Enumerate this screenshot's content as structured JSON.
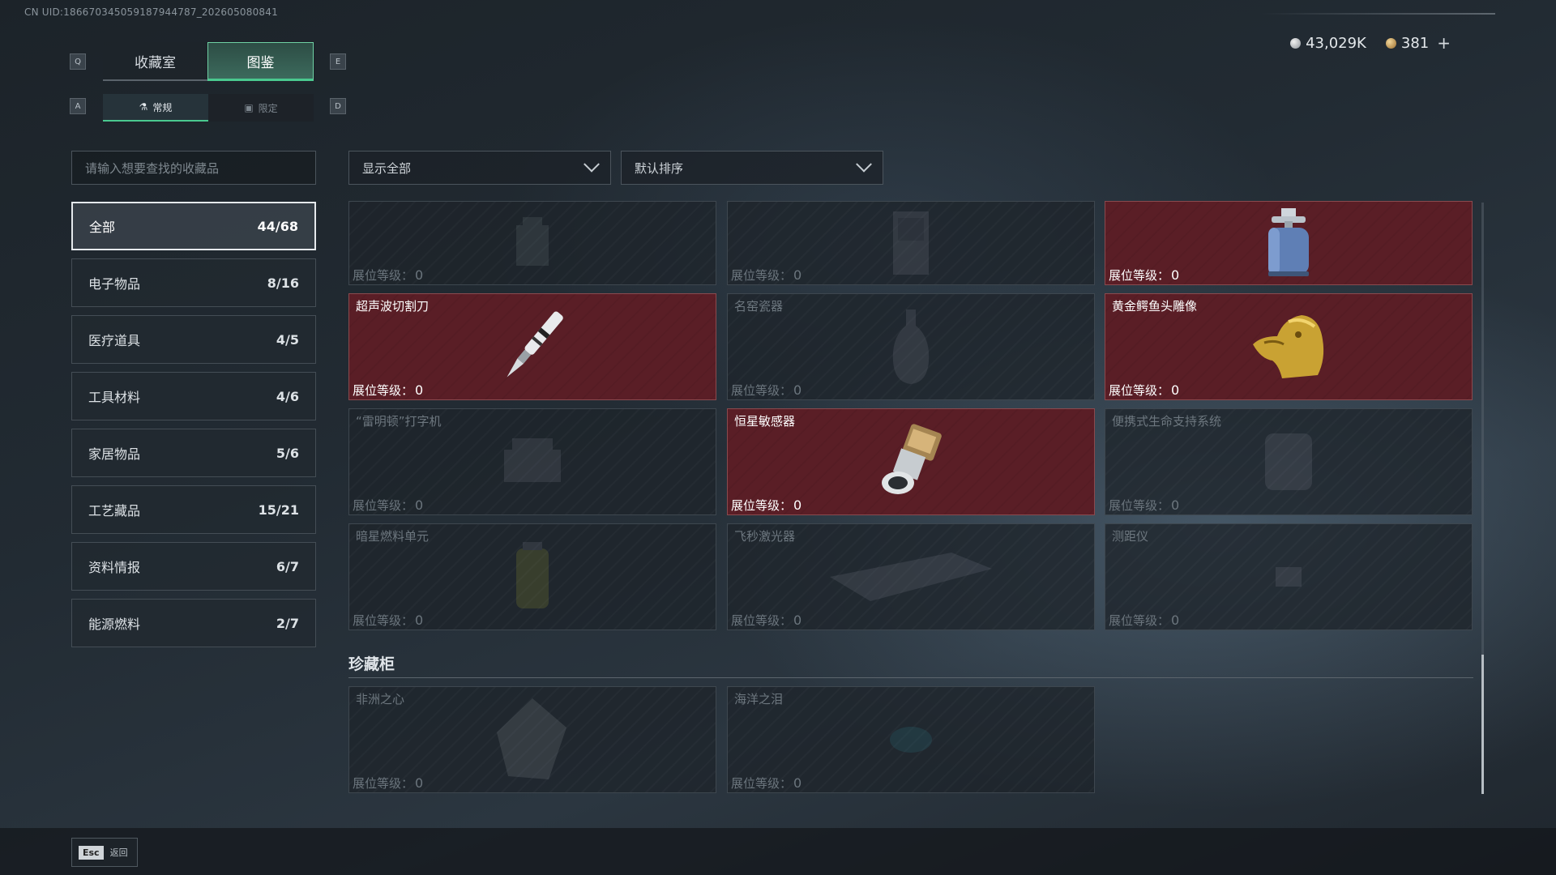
{
  "uid_text": "CN UID:186670345059187944787_202605080841",
  "hints": {
    "q": "Q",
    "e": "E",
    "a": "A",
    "d": "D",
    "esc": "Esc",
    "back": "返回"
  },
  "tabs": [
    {
      "label": "收藏室",
      "active": false
    },
    {
      "label": "图鉴",
      "active": true
    }
  ],
  "subtabs": [
    {
      "label": "常规",
      "icon": "flask-icon",
      "active": true
    },
    {
      "label": "限定",
      "icon": "picture-icon",
      "active": false
    }
  ],
  "currency": {
    "silver": "43,029K",
    "gold": "381",
    "add": "+"
  },
  "search": {
    "placeholder": "请输入想要查找的收藏品"
  },
  "categories": [
    {
      "label": "全部",
      "count": "44/68",
      "active": true
    },
    {
      "label": "电子物品",
      "count": "8/16"
    },
    {
      "label": "医疗道具",
      "count": "4/5"
    },
    {
      "label": "工具材料",
      "count": "4/6"
    },
    {
      "label": "家居物品",
      "count": "5/6"
    },
    {
      "label": "工艺藏品",
      "count": "15/21"
    },
    {
      "label": "资料情报",
      "count": "6/7"
    },
    {
      "label": "能源燃料",
      "count": "2/7"
    }
  ],
  "filters": {
    "show": "显示全部",
    "sort": "默认排序"
  },
  "level_label": "展位等级：",
  "items": [
    {
      "name": "",
      "level": "0",
      "owned": false,
      "icon": "machine-icon"
    },
    {
      "name": "",
      "level": "0",
      "owned": false,
      "icon": "cabinet-icon"
    },
    {
      "name": "",
      "level": "0",
      "owned": true,
      "icon": "gas-canister-icon"
    },
    {
      "name": "超声波切割刀",
      "level": "0",
      "owned": true,
      "icon": "ultrasonic-knife-icon"
    },
    {
      "name": "名窑瓷器",
      "level": "0",
      "owned": false,
      "icon": "vase-icon"
    },
    {
      "name": "黄金鳄鱼头雕像",
      "level": "0",
      "owned": true,
      "icon": "gold-crocodile-icon"
    },
    {
      "name": "“雷明顿”打字机",
      "level": "0",
      "owned": false,
      "icon": "typewriter-icon"
    },
    {
      "name": "恒星敏感器",
      "level": "0",
      "owned": true,
      "icon": "star-sensor-icon"
    },
    {
      "name": "便携式生命支持系统",
      "level": "0",
      "owned": false,
      "icon": "life-support-icon"
    },
    {
      "name": "暗星燃料单元",
      "level": "0",
      "owned": false,
      "icon": "fuel-cell-icon"
    },
    {
      "name": "飞秒激光器",
      "level": "0",
      "owned": false,
      "icon": "laser-icon"
    },
    {
      "name": "测距仪",
      "level": "0",
      "owned": false,
      "icon": "rangefinder-icon"
    }
  ],
  "section": {
    "title": "珍藏柜"
  },
  "treasures": [
    {
      "name": "非洲之心",
      "level": "0",
      "owned": false,
      "icon": "diamond-icon"
    },
    {
      "name": "海洋之泪",
      "level": "0",
      "owned": false,
      "icon": "gem-icon"
    }
  ]
}
